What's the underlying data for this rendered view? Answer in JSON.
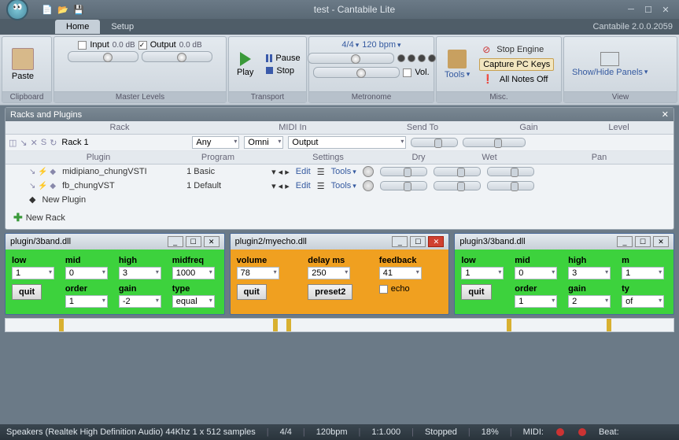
{
  "title": "test - Cantabile Lite",
  "version": "Cantabile 2.0.0.2059",
  "tabs": [
    "Home",
    "Setup"
  ],
  "ribbon": {
    "clipboard": "Clipboard",
    "paste": "Paste",
    "master": "Master Levels",
    "input": "Input",
    "output": "Output",
    "in_db": "0.0 dB",
    "out_db": "0.0 dB",
    "transport": "Transport",
    "play": "Play",
    "pause": "Pause",
    "stop": "Stop",
    "metronome": "Metronome",
    "timesig": "4/4",
    "tempo": "120 bpm",
    "vol": "Vol.",
    "misc": "Misc.",
    "tools": "Tools",
    "stop_engine": "Stop Engine",
    "capture": "Capture PC Keys",
    "allnotes": "All Notes Off",
    "view": "View",
    "panels": "Show/Hide Panels"
  },
  "racks_panel": {
    "title": "Racks and Plugins",
    "cols": {
      "rack": "Rack",
      "midi_in": "MIDI In",
      "send_to": "Send To",
      "gain": "Gain",
      "level": "Level"
    },
    "rack_name": "Rack 1",
    "any": "Any",
    "omni": "Omni",
    "output": "Output",
    "subcols": {
      "plugin": "Plugin",
      "program": "Program",
      "settings": "Settings",
      "dry": "Dry",
      "wet": "Wet",
      "pan": "Pan"
    },
    "plugins": [
      {
        "name": "midipiano_chungVSTI",
        "program": "1 Basic",
        "edit": "Edit",
        "tools": "Tools"
      },
      {
        "name": "fb_chungVST",
        "program": "1 Default",
        "edit": "Edit",
        "tools": "Tools"
      }
    ],
    "new_plugin": "New Plugin",
    "new_rack": "New Rack"
  },
  "pwins": [
    {
      "title": "plugin/3band.dll",
      "bg": "green",
      "rows": [
        [
          {
            "l": "low",
            "v": "1"
          },
          {
            "l": "mid",
            "v": "0"
          },
          {
            "l": "high",
            "v": "3"
          },
          {
            "l": "midfreq",
            "v": "1000"
          }
        ],
        [
          {
            "l": "",
            "btn": "quit"
          },
          {
            "l": "order",
            "v": "1"
          },
          {
            "l": "gain",
            "v": "-2"
          },
          {
            "l": "type",
            "v": "equal"
          }
        ]
      ]
    },
    {
      "title": "plugin2/myecho.dll",
      "bg": "orange",
      "rows": [
        [
          {
            "l": "volume",
            "v": "78"
          },
          {
            "l": "delay ms",
            "v": "250"
          },
          {
            "l": "feedback",
            "v": "41"
          }
        ],
        [
          {
            "l": "",
            "btn": "quit"
          },
          {
            "l": "",
            "btn": "preset2"
          },
          {
            "l": "",
            "chk": "echo"
          }
        ]
      ]
    },
    {
      "title": "plugin3/3band.dll",
      "bg": "green",
      "rows": [
        [
          {
            "l": "low",
            "v": "1"
          },
          {
            "l": "mid",
            "v": "0"
          },
          {
            "l": "high",
            "v": "3"
          },
          {
            "l": "m",
            "v": "1"
          }
        ],
        [
          {
            "l": "",
            "btn": "quit"
          },
          {
            "l": "order",
            "v": "1"
          },
          {
            "l": "gain",
            "v": "2"
          },
          {
            "l": "ty",
            "v": "of"
          }
        ]
      ]
    }
  ],
  "status": {
    "device": "Speakers (Realtek High Definition Audio) 44Khz 1 x 512 samples",
    "timesig": "4/4",
    "tempo": "120bpm",
    "ratio": "1:1.000",
    "state": "Stopped",
    "load": "18%",
    "midi": "MIDI:",
    "beat": "Beat:"
  }
}
